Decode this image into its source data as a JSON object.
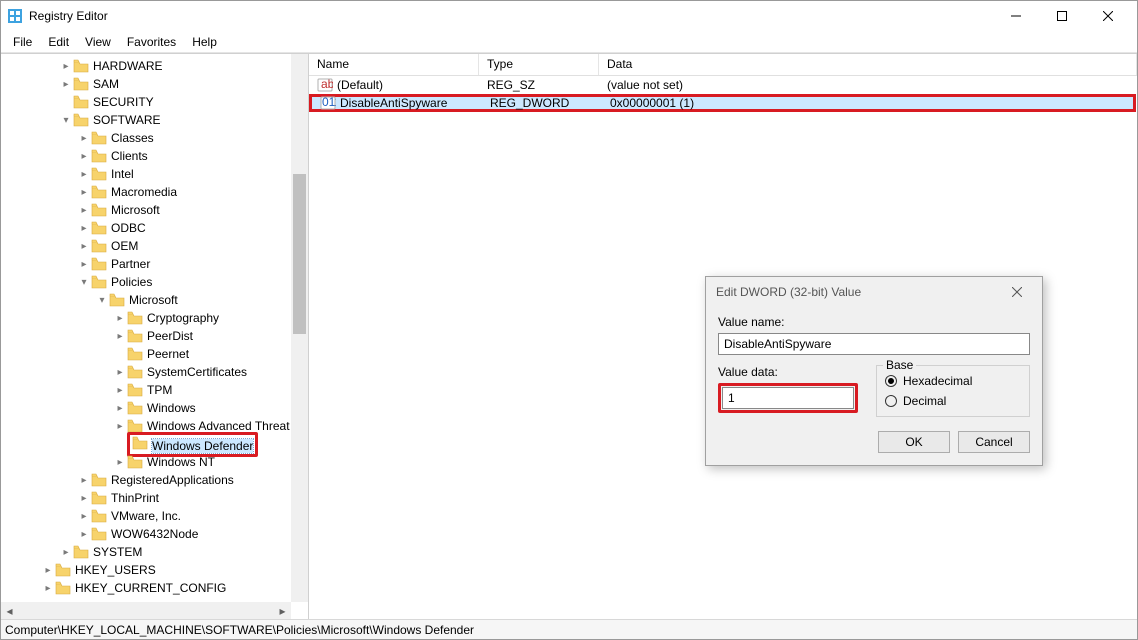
{
  "window": {
    "title": "Registry Editor"
  },
  "menu": [
    "File",
    "Edit",
    "View",
    "Favorites",
    "Help"
  ],
  "tree": [
    {
      "depth": 2,
      "exp": ">",
      "label": "HARDWARE"
    },
    {
      "depth": 2,
      "exp": ">",
      "label": "SAM"
    },
    {
      "depth": 2,
      "exp": "",
      "label": "SECURITY"
    },
    {
      "depth": 2,
      "exp": "v",
      "label": "SOFTWARE"
    },
    {
      "depth": 3,
      "exp": ">",
      "label": "Classes"
    },
    {
      "depth": 3,
      "exp": ">",
      "label": "Clients"
    },
    {
      "depth": 3,
      "exp": ">",
      "label": "Intel"
    },
    {
      "depth": 3,
      "exp": ">",
      "label": "Macromedia"
    },
    {
      "depth": 3,
      "exp": ">",
      "label": "Microsoft"
    },
    {
      "depth": 3,
      "exp": ">",
      "label": "ODBC"
    },
    {
      "depth": 3,
      "exp": ">",
      "label": "OEM"
    },
    {
      "depth": 3,
      "exp": ">",
      "label": "Partner"
    },
    {
      "depth": 3,
      "exp": "v",
      "label": "Policies"
    },
    {
      "depth": 4,
      "exp": "v",
      "label": "Microsoft"
    },
    {
      "depth": 5,
      "exp": ">",
      "label": "Cryptography"
    },
    {
      "depth": 5,
      "exp": ">",
      "label": "PeerDist"
    },
    {
      "depth": 5,
      "exp": "",
      "label": "Peernet"
    },
    {
      "depth": 5,
      "exp": ">",
      "label": "SystemCertificates"
    },
    {
      "depth": 5,
      "exp": ">",
      "label": "TPM"
    },
    {
      "depth": 5,
      "exp": ">",
      "label": "Windows"
    },
    {
      "depth": 5,
      "exp": ">",
      "label": "Windows Advanced Threat P"
    },
    {
      "depth": 5,
      "exp": "",
      "label": "Windows Defender",
      "selected": true,
      "hl": true
    },
    {
      "depth": 5,
      "exp": ">",
      "label": "Windows NT"
    },
    {
      "depth": 3,
      "exp": ">",
      "label": "RegisteredApplications"
    },
    {
      "depth": 3,
      "exp": ">",
      "label": "ThinPrint"
    },
    {
      "depth": 3,
      "exp": ">",
      "label": "VMware, Inc."
    },
    {
      "depth": 3,
      "exp": ">",
      "label": "WOW6432Node"
    },
    {
      "depth": 2,
      "exp": ">",
      "label": "SYSTEM"
    },
    {
      "depth": 1,
      "exp": ">",
      "label": "HKEY_USERS"
    },
    {
      "depth": 1,
      "exp": ">",
      "label": "HKEY_CURRENT_CONFIG"
    }
  ],
  "list": {
    "columns": {
      "name": "Name",
      "type": "Type",
      "data": "Data"
    },
    "rows": [
      {
        "icon": "sz",
        "name": "(Default)",
        "type": "REG_SZ",
        "data": "(value not set)"
      },
      {
        "icon": "dw",
        "name": "DisableAntiSpyware",
        "type": "REG_DWORD",
        "data": "0x00000001 (1)",
        "selected": true,
        "hl": true
      }
    ]
  },
  "dialog": {
    "title": "Edit DWORD (32-bit) Value",
    "valueName_label": "Value name:",
    "valueName": "DisableAntiSpyware",
    "valueData_label": "Value data:",
    "valueData": "1",
    "base_label": "Base",
    "hex_label": "Hexadecimal",
    "dec_label": "Decimal",
    "ok": "OK",
    "cancel": "Cancel"
  },
  "status": "Computer\\HKEY_LOCAL_MACHINE\\SOFTWARE\\Policies\\Microsoft\\Windows Defender"
}
